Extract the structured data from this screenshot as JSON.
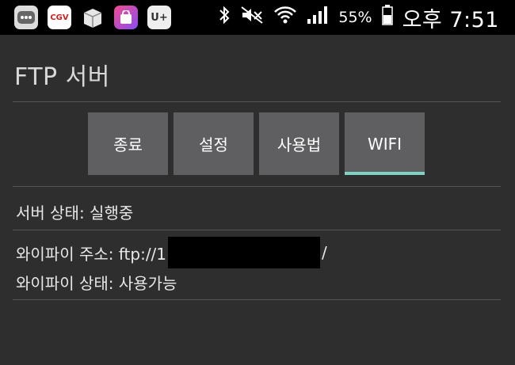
{
  "status_bar": {
    "app_icons": [
      "message-icon",
      "cgv-icon",
      "box-icon",
      "store-icon",
      "u-plus-icon"
    ],
    "cgv_label": "CGV",
    "u_label": "U+",
    "battery": "55%",
    "time": "오후 7:51"
  },
  "app": {
    "title": "FTP 서버"
  },
  "tabs": [
    {
      "label": "종료"
    },
    {
      "label": "설정"
    },
    {
      "label": "사용법"
    },
    {
      "label": "WIFI",
      "active": true
    }
  ],
  "server_status": "서버 상태: 실행중",
  "wifi": {
    "address_prefix": "와이파이 주소: ftp://1",
    "address_suffix": "/",
    "status": "와이파이 상태: 사용가능"
  },
  "colors": {
    "background": "#2e2e2e",
    "button": "#5f5f62",
    "active_indicator": "#7ed3c4"
  }
}
